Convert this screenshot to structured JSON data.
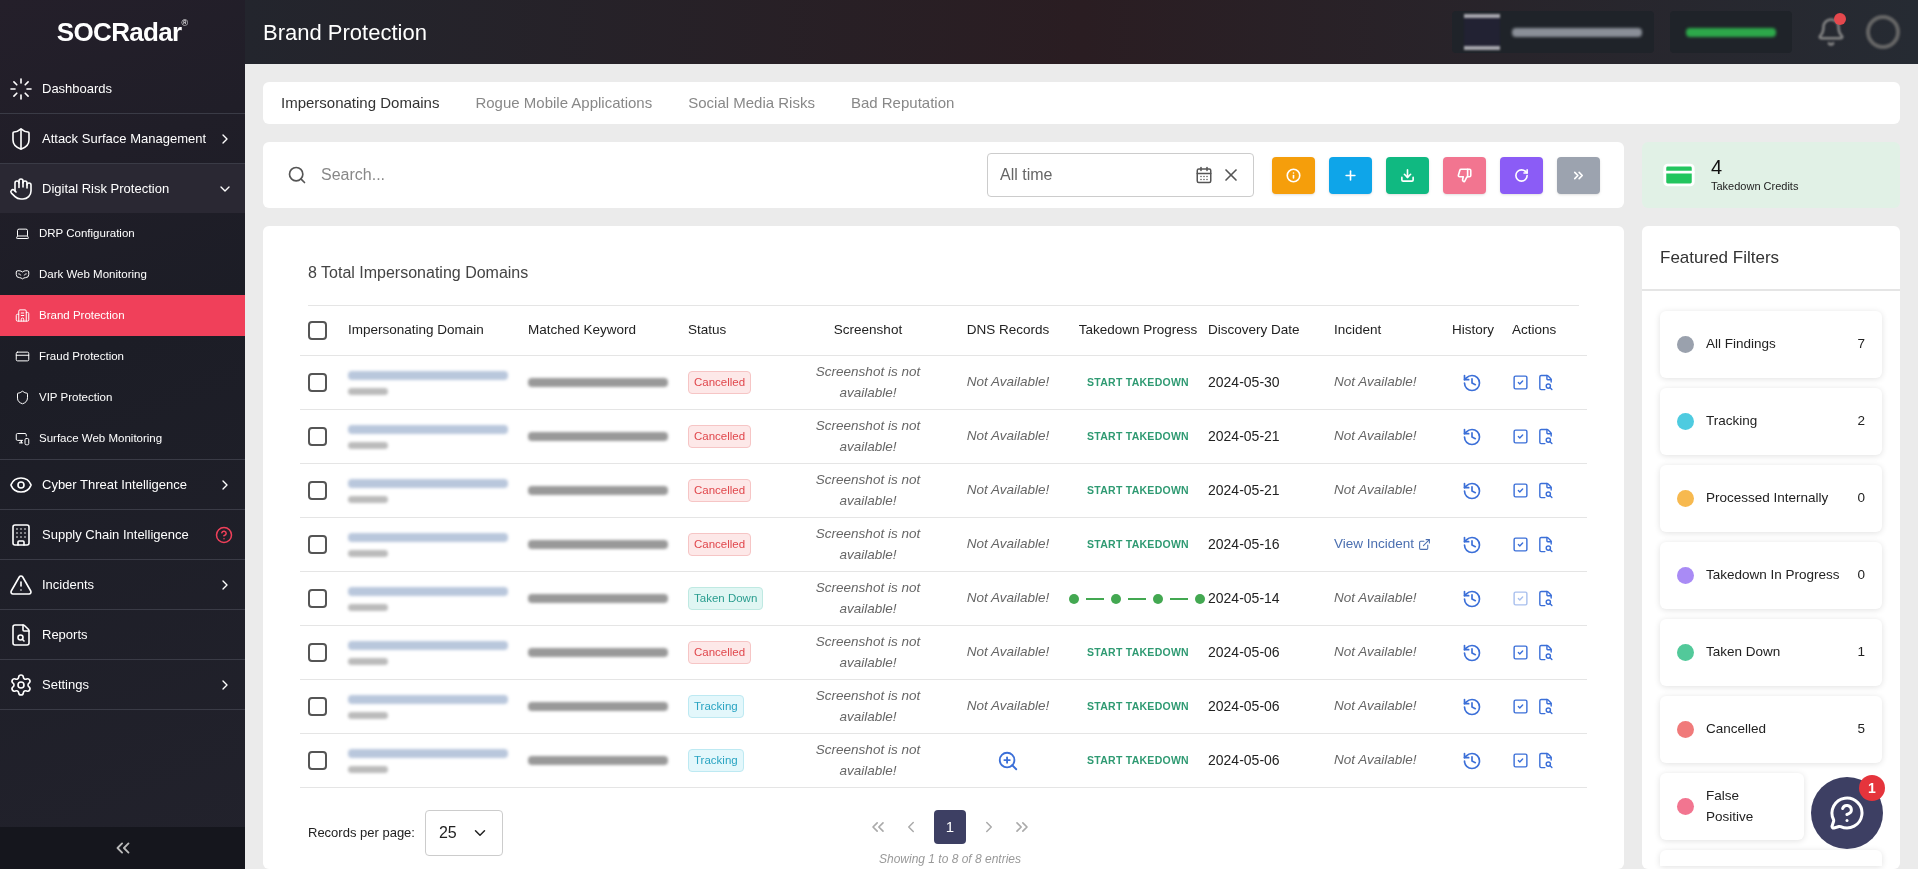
{
  "sidebar": {
    "logo": "SOCRadar",
    "logo_mark": "®",
    "items": [
      {
        "label": "Dashboards",
        "kind": "menu"
      },
      {
        "label": "Attack Surface Management",
        "kind": "menu",
        "expanded": false
      },
      {
        "label": "Digital Risk Protection",
        "kind": "menu",
        "expanded": true,
        "children": [
          {
            "label": "DRP Configuration",
            "selected": false
          },
          {
            "label": "Dark Web Monitoring",
            "selected": false
          },
          {
            "label": "Brand Protection",
            "selected": true
          },
          {
            "label": "Fraud Protection",
            "selected": false
          },
          {
            "label": "VIP Protection",
            "selected": false
          },
          {
            "label": "Surface Web Monitoring",
            "selected": false
          }
        ]
      },
      {
        "label": "Cyber Threat Intelligence",
        "kind": "menu",
        "expanded": false
      },
      {
        "label": "Supply Chain Intelligence",
        "kind": "menu-help"
      },
      {
        "label": "Incidents",
        "kind": "menu",
        "expanded": false
      },
      {
        "label": "Reports",
        "kind": "menu"
      },
      {
        "label": "Settings",
        "kind": "menu",
        "expanded": false
      }
    ]
  },
  "header": {
    "title": "Brand Protection"
  },
  "tabs": [
    {
      "label": "Impersonating Domains",
      "selected": true
    },
    {
      "label": "Rogue Mobile Applications",
      "selected": false
    },
    {
      "label": "Social Media Risks",
      "selected": false
    },
    {
      "label": "Bad Reputation",
      "selected": false
    }
  ],
  "search": {
    "placeholder": "Search...",
    "date_range": "All time"
  },
  "credits": {
    "count": "4",
    "label": "Takedown Credits"
  },
  "table": {
    "title": "8 Total Impersonating Domains",
    "all_checked": false,
    "columns": [
      "Impersonating Domain",
      "Matched Keyword",
      "Status",
      "Screenshot",
      "DNS Records",
      "Takedown Progress",
      "Discovery Date",
      "Incident",
      "History",
      "Actions"
    ],
    "rows": [
      {
        "checked": false,
        "status": {
          "kind": "cancelled",
          "text": "Cancelled"
        },
        "screenshot": "Screenshot is not available!",
        "dns": {
          "kind": "text",
          "text": "Not Available!"
        },
        "takedown": {
          "kind": "button",
          "text": "START TAKEDOWN"
        },
        "date": "2024-05-30",
        "incident": {
          "kind": "text",
          "text": "Not Available!"
        },
        "approve_disabled": false
      },
      {
        "checked": false,
        "status": {
          "kind": "cancelled",
          "text": "Cancelled"
        },
        "screenshot": "Screenshot is not available!",
        "dns": {
          "kind": "text",
          "text": "Not Available!"
        },
        "takedown": {
          "kind": "button",
          "text": "START TAKEDOWN"
        },
        "date": "2024-05-21",
        "incident": {
          "kind": "text",
          "text": "Not Available!"
        },
        "approve_disabled": false
      },
      {
        "checked": false,
        "status": {
          "kind": "cancelled",
          "text": "Cancelled"
        },
        "screenshot": "Screenshot is not available!",
        "dns": {
          "kind": "text",
          "text": "Not Available!"
        },
        "takedown": {
          "kind": "button",
          "text": "START TAKEDOWN"
        },
        "date": "2024-05-21",
        "incident": {
          "kind": "text",
          "text": "Not Available!"
        },
        "approve_disabled": false
      },
      {
        "checked": false,
        "status": {
          "kind": "cancelled",
          "text": "Cancelled"
        },
        "screenshot": "Screenshot is not available!",
        "dns": {
          "kind": "text",
          "text": "Not Available!"
        },
        "takedown": {
          "kind": "button",
          "text": "START TAKEDOWN"
        },
        "date": "2024-05-16",
        "incident": {
          "kind": "link",
          "text": "View Incident"
        },
        "approve_disabled": false
      },
      {
        "checked": false,
        "status": {
          "kind": "taken_down",
          "text": "Taken Down"
        },
        "screenshot": "Screenshot is not available!",
        "dns": {
          "kind": "text",
          "text": "Not Available!"
        },
        "takedown": {
          "kind": "progress"
        },
        "date": "2024-05-14",
        "incident": {
          "kind": "text",
          "text": "Not Available!"
        },
        "approve_disabled": true
      },
      {
        "checked": false,
        "status": {
          "kind": "cancelled",
          "text": "Cancelled"
        },
        "screenshot": "Screenshot is not available!",
        "dns": {
          "kind": "text",
          "text": "Not Available!"
        },
        "takedown": {
          "kind": "button",
          "text": "START TAKEDOWN"
        },
        "date": "2024-05-06",
        "incident": {
          "kind": "text",
          "text": "Not Available!"
        },
        "approve_disabled": false
      },
      {
        "checked": false,
        "status": {
          "kind": "tracking",
          "text": "Tracking"
        },
        "screenshot": "Screenshot is not available!",
        "dns": {
          "kind": "text",
          "text": "Not Available!"
        },
        "takedown": {
          "kind": "button",
          "text": "START TAKEDOWN"
        },
        "date": "2024-05-06",
        "incident": {
          "kind": "text",
          "text": "Not Available!"
        },
        "approve_disabled": false
      },
      {
        "checked": false,
        "status": {
          "kind": "tracking",
          "text": "Tracking"
        },
        "screenshot": "Screenshot is not available!",
        "dns": {
          "kind": "search"
        },
        "takedown": {
          "kind": "button",
          "text": "START TAKEDOWN"
        },
        "date": "2024-05-06",
        "incident": {
          "kind": "text",
          "text": "Not Available!"
        },
        "approve_disabled": false
      }
    ]
  },
  "pagination": {
    "records_label": "Records per page:",
    "records_value": "25",
    "pages": [
      {
        "label": "1",
        "selected": true
      }
    ],
    "summary": "Showing 1 to 8 of 8 entries"
  },
  "filters": {
    "title": "Featured Filters",
    "items": [
      {
        "label": "All Findings",
        "count": "7",
        "color": "#9aa1ad"
      },
      {
        "label": "Tracking",
        "count": "2",
        "color": "#4ecbe0"
      },
      {
        "label": "Processed Internally",
        "count": "0",
        "color": "#f7b94f"
      },
      {
        "label": "Takedown In Progress",
        "count": "0",
        "color": "#a98bf5"
      },
      {
        "label": "Taken Down",
        "count": "1",
        "color": "#52c99a"
      },
      {
        "label": "Cancelled",
        "count": "5",
        "color": "#f07a7a"
      },
      {
        "label": "False Positive",
        "color": "#f27590"
      }
    ]
  },
  "help_widget": {
    "badge": "1"
  }
}
